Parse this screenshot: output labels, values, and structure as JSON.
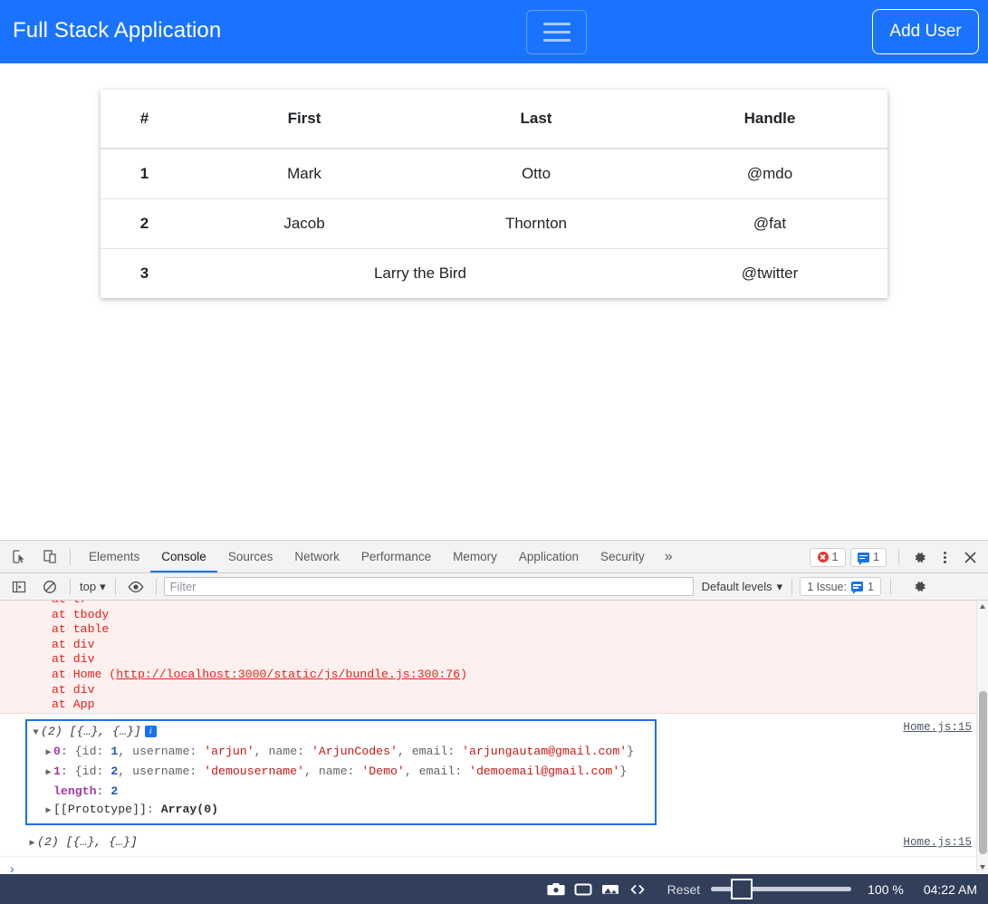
{
  "app": {
    "title": "Full Stack Application",
    "nav_toggle_icon": "hamburger-menu-icon",
    "add_user_label": "Add User",
    "brand_color": "#1a73ff"
  },
  "table": {
    "headers": [
      "#",
      "First",
      "Last",
      "Handle"
    ],
    "rows": [
      {
        "num": "1",
        "first": "Mark",
        "last": "Otto",
        "handle": "@mdo",
        "merged": false
      },
      {
        "num": "2",
        "first": "Jacob",
        "last": "Thornton",
        "handle": "@fat",
        "merged": false
      },
      {
        "num": "3",
        "merged_cell": "Larry the Bird",
        "handle": "@twitter",
        "merged": true
      }
    ]
  },
  "devtools": {
    "icons": {
      "inspect": "inspect-element-icon",
      "device": "device-toolbar-icon"
    },
    "tabs": [
      {
        "label": "Elements",
        "active": false
      },
      {
        "label": "Console",
        "active": true
      },
      {
        "label": "Sources",
        "active": false
      },
      {
        "label": "Network",
        "active": false
      },
      {
        "label": "Performance",
        "active": false
      },
      {
        "label": "Memory",
        "active": false
      },
      {
        "label": "Application",
        "active": false
      },
      {
        "label": "Security",
        "active": false
      }
    ],
    "more_tabs_label": "»",
    "error_count": "1",
    "message_count": "1",
    "settings_icon": "gear-icon",
    "more_options_icon": "kebab-menu-icon",
    "close_icon": "close-icon",
    "filterbar": {
      "sidebar_icon": "console-sidebar-icon",
      "clear_icon": "clear-console-icon",
      "context": "top",
      "eye_icon": "live-expression-eye-icon",
      "filter_placeholder": "Filter",
      "filter_value": "",
      "levels": "Default levels",
      "issues_label": "1 Issue:",
      "issues_count": "1",
      "gear_icon": "gear-icon"
    },
    "console": {
      "stack_trace": [
        "at tr",
        "at tbody",
        "at table",
        "at div",
        "at div",
        "at Home (",
        "at div",
        "at App"
      ],
      "stack_link_text": "http://localhost:3000/static/js/bundle.js:300:76",
      "stack_link_close": ")",
      "selected_log": {
        "summary": "(2) [{…}, {…}]",
        "info_badge": "i",
        "source": "Home.js:15",
        "entries": [
          {
            "index": "0",
            "preview_open": ": {",
            "fields": [
              {
                "key": "id",
                "sep": ": ",
                "value": "1",
                "type": "num"
              },
              {
                "key": ", username",
                "sep": ": ",
                "value": "'arjun'",
                "type": "str"
              },
              {
                "key": ", name",
                "sep": ": ",
                "value": "'ArjunCodes'",
                "type": "str"
              },
              {
                "key": ", email",
                "sep": ": ",
                "value": "'arjungautam@gmail.com'",
                "type": "str"
              }
            ],
            "preview_close": "}"
          },
          {
            "index": "1",
            "preview_open": ": {",
            "fields": [
              {
                "key": "id",
                "sep": ": ",
                "value": "2",
                "type": "num"
              },
              {
                "key": ", username",
                "sep": ": ",
                "value": "'demousername'",
                "type": "str"
              },
              {
                "key": ", name",
                "sep": ": ",
                "value": "'Demo'",
                "type": "str"
              },
              {
                "key": ", email",
                "sep": ": ",
                "value": "'demoemail@gmail.com'",
                "type": "str"
              }
            ],
            "preview_close": "}"
          }
        ],
        "length_key": "length",
        "length_value": "2",
        "prototype_key": "[[Prototype]]",
        "prototype_value": "Array(0)"
      },
      "collapsed_log": {
        "summary": "(2) [{…}, {…}]",
        "source": "Home.js:15"
      },
      "prompt_caret": "›"
    }
  },
  "statusbar": {
    "icons": [
      "camera-icon",
      "screen-icon",
      "image-icon",
      "code-icon"
    ],
    "reset_label": "Reset",
    "zoom_level": "100 %",
    "time": "04:22 AM"
  }
}
